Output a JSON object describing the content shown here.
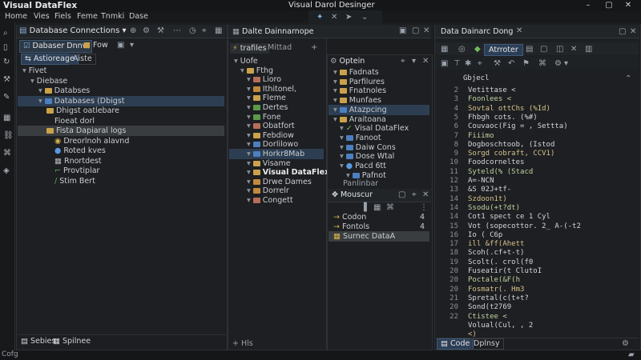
{
  "window": {
    "app_title": "Visual DataFlex",
    "designer_title": "Visual Darol Desinger",
    "min": "–",
    "max": "▢",
    "close": "✕"
  },
  "menu": [
    "Home",
    "Vies",
    "Fiels",
    "Feme",
    "Tnmki",
    "Dase"
  ],
  "db_panel": {
    "tab_label": "Database Connections",
    "toolbar": {
      "browser_label": "Dabaser Dnnw",
      "flow_label": "Fow"
    },
    "subtabs": [
      "Astioreage",
      "Aiste"
    ],
    "tree": [
      {
        "label": "Fivet",
        "indent": 0,
        "icon": "none"
      },
      {
        "label": "Diebase",
        "indent": 1,
        "icon": "none"
      },
      {
        "label": "Databses",
        "indent": 2,
        "icon": "folder"
      },
      {
        "label": "Databases (Dbigst",
        "indent": 2,
        "icon": "folder-blue",
        "selected": true
      },
      {
        "label": "Dhigst oatlebare",
        "indent": 3,
        "icon": "folder"
      },
      {
        "label": "Fioeat dorl",
        "indent": 4,
        "icon": "none"
      },
      {
        "label": "Fista Dapiaral logs",
        "indent": 3,
        "icon": "folder",
        "selected2": true
      },
      {
        "label": "Dreorlnoh alavnd",
        "indent": 4,
        "icon": "bullet"
      },
      {
        "label": "Roted kves",
        "indent": 4,
        "icon": "dot"
      },
      {
        "label": "Rnortdest",
        "indent": 4,
        "icon": "grid"
      },
      {
        "label": "Provtiplar",
        "indent": 4,
        "icon": "hook"
      },
      {
        "label": "Stim Bert",
        "indent": 4,
        "icon": "pen"
      }
    ],
    "bottom_tabs": [
      "Sebies",
      "Spilnee"
    ]
  },
  "designer_panel": {
    "tab_label": "Dalte Dainnarnope",
    "toolbar": {
      "left_label": "trafiles",
      "right_label": "Mittad"
    },
    "tree": [
      {
        "label": "Uofe",
        "indent": 0,
        "icon": "none"
      },
      {
        "label": "Fthg",
        "indent": 1,
        "icon": "folder"
      },
      {
        "label": "Lioro",
        "indent": 2,
        "icon": "folder-r"
      },
      {
        "label": "Ithitonel,",
        "indent": 2,
        "icon": "folder-o"
      },
      {
        "label": "Fleme",
        "indent": 2,
        "icon": "folder"
      },
      {
        "label": "Dertes",
        "indent": 2,
        "icon": "folder-g"
      },
      {
        "label": "Fone",
        "indent": 2,
        "icon": "folder-g"
      },
      {
        "label": "Obatfort",
        "indent": 2,
        "icon": "folder-r"
      },
      {
        "label": "Febdiow",
        "indent": 2,
        "icon": "folder"
      },
      {
        "label": "Dorlilowo",
        "indent": 2,
        "icon": "folder-b"
      },
      {
        "label": "Horkr8Mab",
        "indent": 2,
        "icon": "folder-b",
        "selected": true
      },
      {
        "label": "Visame",
        "indent": 2,
        "icon": "folder"
      },
      {
        "label": "Visual DataFlex",
        "indent": 2,
        "icon": "folder",
        "bold": true
      },
      {
        "label": "Drwe Dames",
        "indent": 2,
        "icon": "folder-o"
      },
      {
        "label": "Dorrelr",
        "indent": 2,
        "icon": "folder-o"
      },
      {
        "label": "Congett",
        "indent": 2,
        "icon": "folder-r"
      }
    ],
    "footer_label": "Hls"
  },
  "options_panel": {
    "tab_label": "Optein",
    "tree": [
      {
        "label": "Fadnats",
        "indent": 0,
        "icon": "folder"
      },
      {
        "label": "Parfilures",
        "indent": 0,
        "icon": "folder"
      },
      {
        "label": "Fnatnoles",
        "indent": 0,
        "icon": "folder"
      },
      {
        "label": "Munfaes",
        "indent": 0,
        "icon": "folder"
      },
      {
        "label": "Atazpcing",
        "indent": 0,
        "icon": "folder-b",
        "selected": true
      },
      {
        "label": "Araitoana",
        "indent": 0,
        "icon": "folder"
      },
      {
        "label": "Visal DataFlex",
        "indent": 1,
        "icon": "check"
      },
      {
        "label": "Fanoot",
        "indent": 1,
        "icon": "folder-b"
      },
      {
        "label": "Daiw Cons",
        "indent": 1,
        "icon": "folder-b"
      },
      {
        "label": "Dose Wtal",
        "indent": 1,
        "icon": "folder-b"
      },
      {
        "label": "Pacd 6tt",
        "indent": 1,
        "icon": "dot"
      },
      {
        "label": "Pafnot",
        "indent": 2,
        "icon": "folder-b"
      }
    ],
    "section_label": "Panlinbar"
  },
  "mouse_panel": {
    "tab_label": "Mouscur",
    "rows": [
      {
        "label": "Codon",
        "value": "4"
      },
      {
        "label": "Fontols",
        "value": "4"
      },
      {
        "label": "Surnec DataA",
        "value": ""
      }
    ]
  },
  "code_panel": {
    "tab_label": "Data Dainarc Dong",
    "toolbar": {
      "arrange_label": "Atrroter"
    },
    "header_label": "Gbjecl",
    "lines": [
      {
        "n": "2",
        "text": "Vetittase <"
      },
      {
        "n": "3",
        "text": "Foonlees <"
      },
      {
        "n": "4",
        "text": "Sovtal ottChs (%Id)"
      },
      {
        "n": "5",
        "text": "Fhbgh cots. (%#)"
      },
      {
        "n": "6",
        "text": "Couvaoc(Fig = ,  Settta)"
      },
      {
        "n": "7",
        "text": "Fiiimo"
      },
      {
        "n": "8",
        "text": "Dogboschtoob, (Istod"
      },
      {
        "n": "9",
        "text": "Sorgd cobraft, CCV1)"
      },
      {
        "n": "10",
        "text": "Foodcorneltes"
      },
      {
        "n": "11",
        "text": "Syteld(% (Stacd"
      },
      {
        "n": "12",
        "text": "A=-NCN"
      },
      {
        "n": "13",
        "text": "&S 02J+tf-"
      },
      {
        "n": "14",
        "text": "Szdoon1t)"
      },
      {
        "n": "14",
        "text": "Ssodu(+t?dt)"
      },
      {
        "n": "14",
        "text": "Cot1 spect ce 1 Cyl"
      },
      {
        "n": "15",
        "text": "Vot (sopecottor. 2_  A-(-t2"
      },
      {
        "n": "16",
        "text": "Io ( C6p"
      },
      {
        "n": "17",
        "text": "ill   &ff(Ahett"
      },
      {
        "n": "18",
        "text": "Scoh(.cf+t-t)"
      },
      {
        "n": "19",
        "text": "Scolt(.  crol(f0"
      },
      {
        "n": "20",
        "text": "Fuseatir(t  ClutoI"
      },
      {
        "n": "20",
        "text": "Poctale(&F(h"
      },
      {
        "n": "20",
        "text": "Fosmatr(.  Hm3"
      },
      {
        "n": "21",
        "text": "Spretal(c(t+t?"
      },
      {
        "n": "20",
        "text": "Sond(t2769"
      },
      {
        "n": "22",
        "text": "Ctistee  <"
      },
      {
        "n": "",
        "text": "Volual(Cul, ,       2"
      },
      {
        "n": "",
        "text": "<)"
      }
    ],
    "bottom_tabs": [
      "Code",
      "Dplnsy"
    ]
  },
  "status": {
    "left_text": "Cofg"
  }
}
